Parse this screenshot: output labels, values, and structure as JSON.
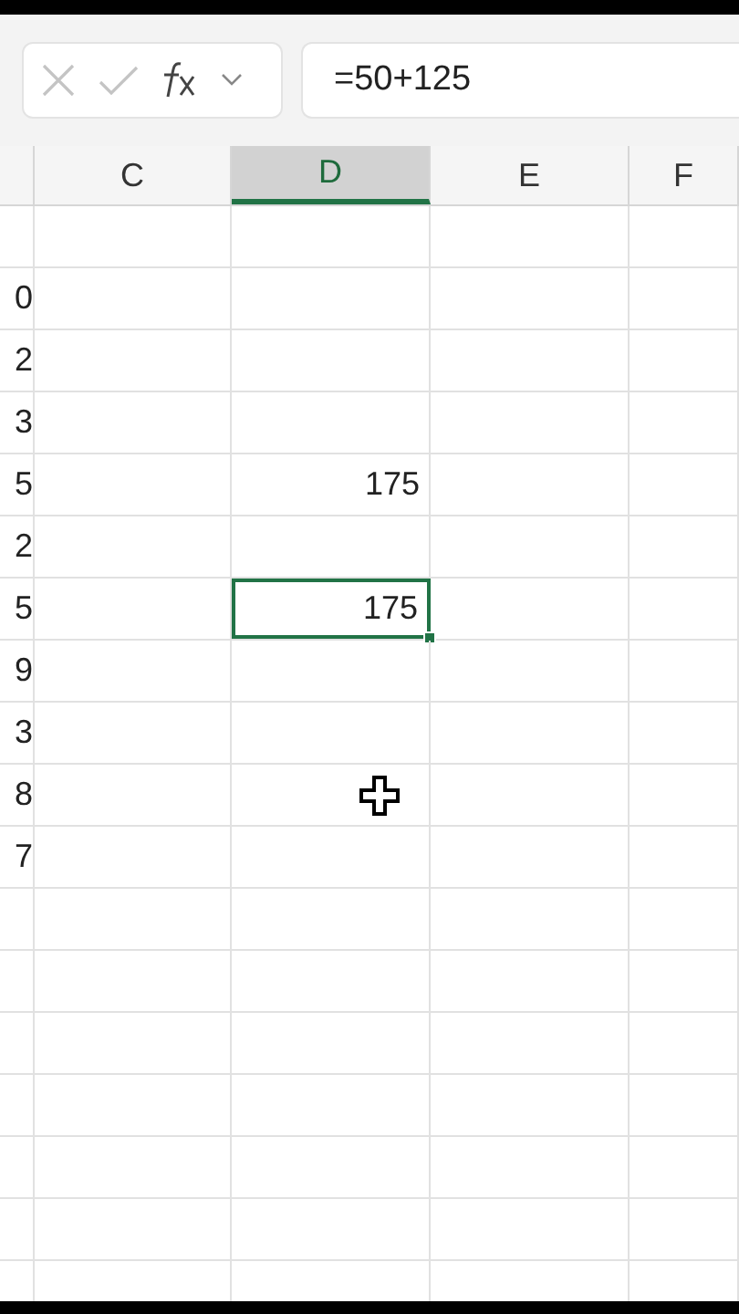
{
  "formula_bar": {
    "formula": "=50+125"
  },
  "columns": [
    {
      "label": "C",
      "selected": false
    },
    {
      "label": "D",
      "selected": true
    },
    {
      "label": "E",
      "selected": false
    },
    {
      "label": "F",
      "selected": false
    }
  ],
  "rows": [
    {
      "d_selected": false
    },
    {
      "column_b": "0",
      "d_selected": false
    },
    {
      "column_b": "2",
      "d_selected": false
    },
    {
      "column_b": "3",
      "d_selected": false
    },
    {
      "column_b": "5",
      "d": "175",
      "d_selected": false
    },
    {
      "column_b": "2",
      "d_selected": false
    },
    {
      "column_b": "5",
      "d": "175",
      "d_selected": true
    },
    {
      "column_b": "9",
      "d_selected": false
    },
    {
      "column_b": "3",
      "d_selected": false
    },
    {
      "column_b": "8",
      "d_selected": false
    },
    {
      "column_b": "7",
      "d_selected": false
    },
    {
      "d_selected": false
    },
    {
      "d_selected": false
    },
    {
      "d_selected": false
    },
    {
      "d_selected": false
    },
    {
      "d_selected": false
    },
    {
      "d_selected": false
    },
    {
      "d_selected": false
    }
  ]
}
